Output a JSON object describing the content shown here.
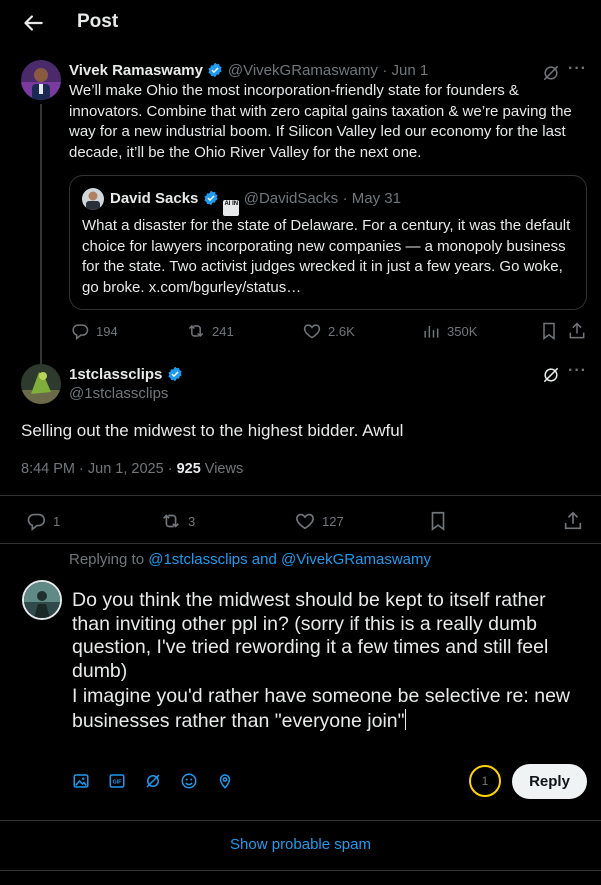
{
  "header": {
    "title": "Post"
  },
  "tweet1": {
    "name": "Vivek Ramaswamy",
    "handle": "@VivekGRamaswamy",
    "date": "· Jun 1",
    "text": "We’ll make Ohio the most incorporation-friendly state for founders & innovators. Combine that with zero capital gains taxation & we’re paving the way for a new industrial boom. If Silicon Valley led our economy for the last decade, it’ll be the Ohio River Valley for the next one.",
    "quote": {
      "name": "David Sacks",
      "badge": "AI IN",
      "handle": "@DavidSacks",
      "date": "· May 31",
      "text": "What a disaster for the state of Delaware. For a century, it was the default choice for lawyers incorporating new companies — a monopoly business for the state. Two activist judges wrecked it in just a few years. Go woke, go broke. x.com/bgurley/status…"
    },
    "stats": {
      "replies": "194",
      "reposts": "241",
      "likes": "2.6K",
      "views": "350K"
    }
  },
  "tweet2": {
    "name": "1stclassclips",
    "handle": "@1stclassclips",
    "text": "Selling out the midwest to the highest bidder. Awful",
    "time": "8:44 PM · Jun 1, 2025 ·",
    "views_count": "925",
    "views_label": "Views",
    "stats": {
      "replies": "1",
      "reposts": "3",
      "likes": "127"
    }
  },
  "compose": {
    "replying_prefix": "Replying to",
    "replying_to": "@1stclassclips and @VivekGRamaswamy",
    "paragraph1": "Do you think the midwest should be kept to itself rather than inviting other ppl in? (sorry if this is a really dumb question, I've tried rewording it a few times and still feel dumb)",
    "paragraph2": "I imagine you'd rather have someone be selective re: new businesses rather than \"everyone join\"",
    "char_counter": "1",
    "reply_label": "Reply",
    "tools": [
      "image-icon",
      "gif-icon",
      "grok-icon",
      "emoji-icon",
      "location-icon"
    ]
  },
  "footer": {
    "spam_link": "Show probable spam"
  },
  "colors": {
    "accent": "#1d9bf0",
    "background": "#000000",
    "muted": "#71767b",
    "counter_ring": "#ffd400"
  }
}
